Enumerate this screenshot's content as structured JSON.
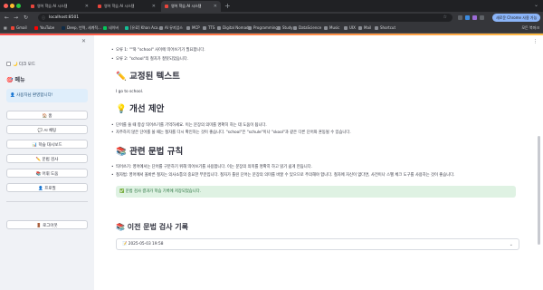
{
  "browser": {
    "tabs": [
      {
        "label": "영어 학습 AI 시스템",
        "active": false
      },
      {
        "label": "영어 학습 AI 시스템",
        "active": false
      },
      {
        "label": "영어 학습 AI 시스템",
        "active": true
      }
    ],
    "url": "localhost:8501",
    "update_label": "새로운 Chrome 사용 가능",
    "bookmarks": [
      {
        "label": "Gmail",
        "color": "#ea4335"
      },
      {
        "label": "YouTube",
        "color": "#ff0000"
      },
      {
        "label": "Deep, 번역, 세계적...",
        "color": "#0f2b46"
      },
      {
        "label": "네이버",
        "color": "#03c75a"
      },
      {
        "label": "[유료] Khan Aca...",
        "color": "#14bf96"
      },
      {
        "label": "AI 뮤지엄스",
        "color": "#8a8d93"
      },
      {
        "label": "MCP",
        "color": "#8a8d93"
      },
      {
        "label": "TTS",
        "color": "#8a8d93"
      },
      {
        "label": "Digital Nomad",
        "color": "#8a8d93"
      },
      {
        "label": "Programming",
        "color": "#8a8d93"
      },
      {
        "label": "Study",
        "color": "#8a8d93"
      },
      {
        "label": "DataScience",
        "color": "#8a8d93"
      },
      {
        "label": "Music",
        "color": "#8a8d93"
      },
      {
        "label": "UIX",
        "color": "#8a8d93"
      },
      {
        "label": "Mail",
        "color": "#8a8d93"
      },
      {
        "label": "Shortcut",
        "color": "#8a8d93"
      }
    ],
    "all_bookmarks_label": "모든 북마크"
  },
  "sidebar": {
    "dark_mode_label": "🌙 다크 모드",
    "menu_title": "🎯 메뉴",
    "welcome": "👤 사용자님 환영합니다!",
    "buttons": [
      {
        "label": "🏠 홈"
      },
      {
        "label": "💬 AI 채팅"
      },
      {
        "label": "📊 학습 대시보드"
      },
      {
        "label": "✏️ 문법 검사"
      },
      {
        "label": "📚 어휘 도움"
      },
      {
        "label": "👤 프로필"
      }
    ],
    "logout": "🚪 로그아웃"
  },
  "main": {
    "top_bullets": [
      "오류 1: \"\"와 \"school\" 사이에 띄어쓰기가 필요합니다.",
      "오류 2: \"school\"의 철자가 잘못되었습니다."
    ],
    "corrected_heading": "✏️ 교정된 텍스트",
    "corrected_text": "I go to school.",
    "improve_heading": "💡 개선 제안",
    "improve_bullets": [
      "단어를 쓸 때 항상 띄어쓰기를 기억하세요. 이는 문장의 의미를 명확히 하는 데 도움이 됩니다.",
      "자주하지 않은 단어를 쓸 때는 철자를 다시 확인하는 것이 좋습니다. \"school\"은 \"schule\"이나 \"skool\"과 같은 다른 단어와 혼동될 수 있습니다."
    ],
    "grammar_heading": "📚 관련 문법 규칙",
    "grammar_bullets": [
      "띄어쓰기: 영어에서는 단어를 구분하기 위해 띄어쓰기를 사용합니다. 이는 문장의 의미를 명확히 하고 읽기 쉽게 만듭니다.",
      "철자법: 영어에서 올바른 철자는 의사소통의 중요한 부분입니다. 철자가 틀린 단어는 문장의 의미를 바꿀 수 있으므로 주의해야 합니다. 철자에 자신이 없다면, 사전이나 스펠 체크 도구를 사용하는 것이 좋습니다."
    ],
    "success_message": "✅ 문법 검사 결과가 학습 기록에 저장되었습니다.",
    "history_heading": "📚 이전 문법 검사 기록",
    "history_item": "📝 2025-05-03 19:58"
  },
  "colors": {
    "accent_red": "#ff4b4b",
    "sidebar_bg": "#f0f2f6",
    "info_bg": "#dfeefb",
    "success_bg": "#dff2e3"
  }
}
